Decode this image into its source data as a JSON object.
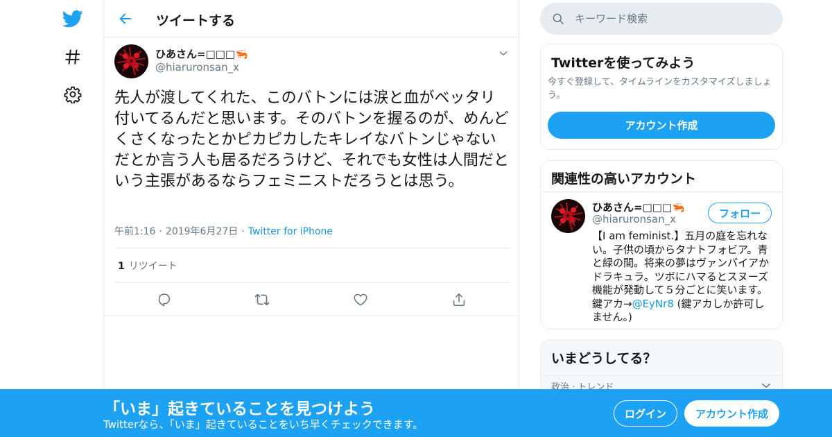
{
  "colors": {
    "accent": "#1da1f2",
    "link": "#1b95e0",
    "text": "#14171a",
    "muted": "#657786",
    "border": "#e6ecf0"
  },
  "nav": {
    "logo_icon": "twitter-bird-icon",
    "explore_icon": "hashtag-icon",
    "settings_icon": "gear-icon"
  },
  "header": {
    "title": "ツイートする",
    "back_icon": "arrow-left-icon"
  },
  "tweet": {
    "author": {
      "name": "ひあさん=□□□🦐",
      "handle": "@hiaruronsan_x"
    },
    "text": "先人が渡してくれた、このバトンには涙と血がベッタリ付いてるんだと思います。そのバトンを握るのが、めんどくさくなったとかピカピカしたキレイなバトンじゃないだとか言う人も居るだろうけど、それでも女性は人間だという主張があるならフェミニストだろうとは思う。",
    "time": "午前1:16",
    "date": "2019年6月27日",
    "source": "Twitter for iPhone",
    "separator": "·",
    "retweet_count": "1",
    "retweet_label": "リツイート"
  },
  "search": {
    "placeholder": "キーワード検索"
  },
  "signup_card": {
    "title": "Twitterを使ってみよう",
    "description": "今すぐ登録して、タイムラインをカスタマイズしましょう。",
    "button": "アカウント作成"
  },
  "related": {
    "title": "関連性の高いアカウント",
    "name": "ひあさん=□□□🦐",
    "handle": "@hiaruronsan_x",
    "follow_button": "フォロー",
    "bio_before": "【I am feminist.】五月の庭を忘れない。子供の頃からタナトフォビア。青と緑の間。将来の夢はヴァンパイアかドラキュラ。ツボにハマるとスヌーズ機能が発動して５分ごとに笑います。鍵アカ→",
    "bio_mention": "@EyNr8",
    "bio_after": " (鍵アカしか許可しません。)"
  },
  "trends": {
    "title": "いまどうしてる？",
    "category": "政治 · トレンド"
  },
  "banner": {
    "title": "「いま」起きていることを見つけよう",
    "subtitle": "Twitterなら、「いま」起きていることをいち早くチェックできます。",
    "login": "ログイン",
    "signup": "アカウント作成"
  }
}
